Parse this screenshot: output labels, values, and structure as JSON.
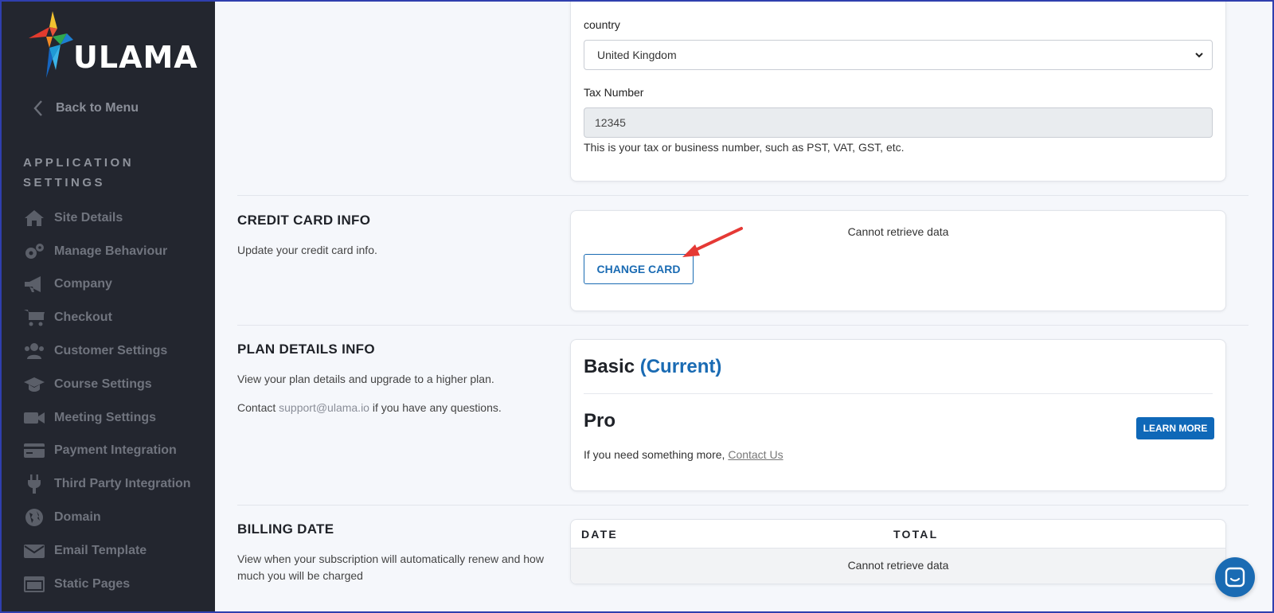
{
  "app": {
    "logo_text": "ULAMA"
  },
  "sidebar": {
    "back_label": "Back to Menu",
    "section_title": "APPLICATION SETTINGS",
    "items": [
      {
        "label": "Site Details",
        "icon": "home-icon"
      },
      {
        "label": "Manage Behaviour",
        "icon": "gears-icon"
      },
      {
        "label": "Company",
        "icon": "megaphone-icon"
      },
      {
        "label": "Checkout",
        "icon": "cart-icon"
      },
      {
        "label": "Customer Settings",
        "icon": "users-icon"
      },
      {
        "label": "Course Settings",
        "icon": "graduation-cap-icon"
      },
      {
        "label": "Meeting Settings",
        "icon": "video-camera-icon"
      },
      {
        "label": "Payment Integration",
        "icon": "credit-card-icon"
      },
      {
        "label": "Third Party Integration",
        "icon": "plug-icon"
      },
      {
        "label": "Domain",
        "icon": "globe-icon"
      },
      {
        "label": "Email Template",
        "icon": "envelope-icon"
      },
      {
        "label": "Static Pages",
        "icon": "window-icon"
      }
    ]
  },
  "company_form": {
    "country_label": "country",
    "country_value": "United Kingdom",
    "tax_label": "Tax Number",
    "tax_value": "12345",
    "tax_help": "This is your tax or business number, such as PST, VAT, GST, etc."
  },
  "credit_card": {
    "heading": "CREDIT CARD INFO",
    "description": "Update your credit card info.",
    "status": "Cannot retrieve data",
    "change_button": "CHANGE CARD"
  },
  "plan": {
    "heading": "PLAN DETAILS INFO",
    "description": "View your plan details and upgrade to a higher plan.",
    "contact_prefix": "Contact ",
    "contact_email": "support@ulama.io",
    "contact_suffix": " if you have any questions.",
    "current_plan": "Basic",
    "current_tag": "(Current)",
    "other_plan": "Pro",
    "learn_more": "LEARN MORE",
    "more_prefix": "If you need something more, ",
    "contact_link": "Contact Us"
  },
  "billing": {
    "heading": "BILLING DATE",
    "description": "View when your subscription will automatically renew and how much you will be charged",
    "col_date": "DATE",
    "col_total": "TOTAL",
    "status": "Cannot retrieve data"
  },
  "colors": {
    "sidebar_bg": "#23262f",
    "accent": "#1a6bb3",
    "annotation_arrow": "#e53935"
  }
}
